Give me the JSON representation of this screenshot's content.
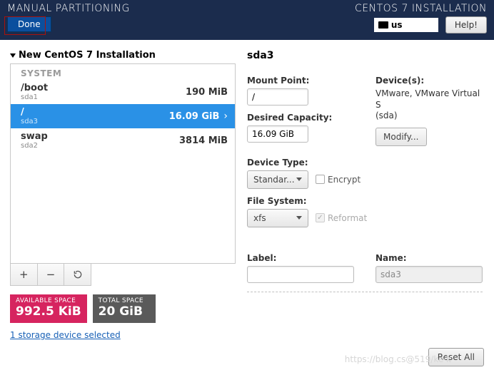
{
  "header": {
    "title_left": "MANUAL PARTITIONING",
    "title_right": "CENTOS 7 INSTALLATION",
    "done_label": "Done",
    "help_label": "Help!",
    "keyboard_layout": "us"
  },
  "tree": {
    "root_label": "New CentOS 7 Installation",
    "section_label": "SYSTEM",
    "partitions": [
      {
        "mount": "/boot",
        "device": "sda1",
        "size": "190 MiB",
        "selected": false
      },
      {
        "mount": "/",
        "device": "sda3",
        "size": "16.09 GiB",
        "selected": true
      },
      {
        "mount": "swap",
        "device": "sda2",
        "size": "3814 MiB",
        "selected": false
      }
    ],
    "add_label": "+",
    "remove_label": "−",
    "refresh_label": "↻"
  },
  "space": {
    "available_label": "AVAILABLE SPACE",
    "available_value": "992.5 KiB",
    "total_label": "TOTAL SPACE",
    "total_value": "20 GiB"
  },
  "storage_link": "1 storage device selected",
  "details": {
    "title": "sda3",
    "mount_point_label": "Mount Point:",
    "mount_point_value": "/",
    "desired_capacity_label": "Desired Capacity:",
    "desired_capacity_value": "16.09 GiB",
    "devices_label": "Device(s):",
    "device_text_line1": "VMware, VMware Virtual S",
    "device_text_line2": "(sda)",
    "modify_label": "Modify...",
    "device_type_label": "Device Type:",
    "device_type_value": "Standar...",
    "encrypt_label": "Encrypt",
    "encrypt_checked": false,
    "filesystem_label": "File System:",
    "filesystem_value": "xfs",
    "reformat_label": "Reformat",
    "reformat_checked": true,
    "label_label": "Label:",
    "label_value": "",
    "name_label": "Name:",
    "name_value": "sda3"
  },
  "footer": {
    "reset_label": "Reset All",
    "watermark": "https://blog.cs@519/ke·k"
  }
}
